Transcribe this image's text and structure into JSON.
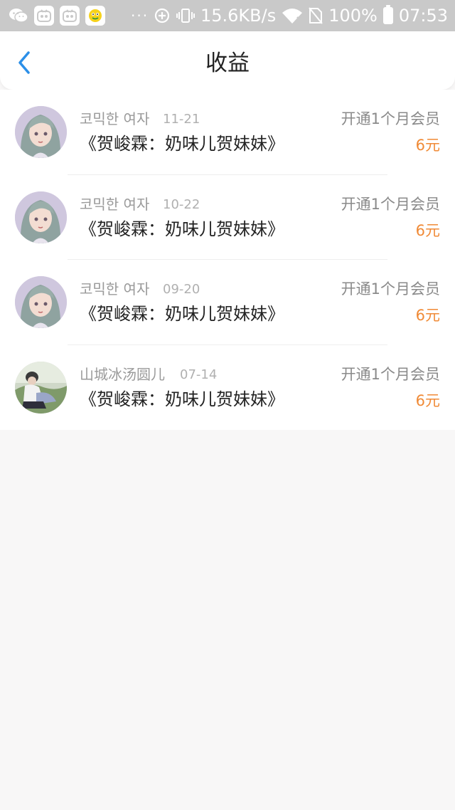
{
  "status_bar": {
    "dots": "···",
    "net_speed": "15.6KB/s",
    "battery_percent": "100%",
    "time": "07:53",
    "icons": [
      "wechat-icon",
      "app-icon",
      "app-icon",
      "yellow-app-icon",
      "data-saver-icon",
      "vibrate-icon",
      "wifi-icon",
      "no-sim-icon",
      "battery-icon"
    ]
  },
  "header": {
    "title": "收益",
    "back_icon": "chevron-left-icon",
    "accent_color": "#2b8fe8"
  },
  "earnings": [
    {
      "username": "코믹한 여자",
      "date": "11-21",
      "title": "《贺峻霖：奶味儿贺妹妹》",
      "description": "开通1个月会员",
      "amount": "6元",
      "avatar": "anime-girl-avatar"
    },
    {
      "username": "코믹한 여자",
      "date": "10-22",
      "title": "《贺峻霖：奶味儿贺妹妹》",
      "description": "开通1个月会员",
      "amount": "6元",
      "avatar": "anime-girl-avatar"
    },
    {
      "username": "코믹한 여자",
      "date": "09-20",
      "title": "《贺峻霖：奶味儿贺妹妹》",
      "description": "开通1个月会员",
      "amount": "6元",
      "avatar": "anime-girl-avatar"
    },
    {
      "username": "山城冰汤圆儿",
      "date": "07-14",
      "title": "《贺峻霖：奶味儿贺妹妹》",
      "description": "开通1个月会员",
      "amount": "6元",
      "avatar": "outdoor-photo-avatar"
    }
  ],
  "colors": {
    "amount": "#f08a36",
    "page_background": "#f8f7f7",
    "status_bar": "#c9c9c9"
  }
}
